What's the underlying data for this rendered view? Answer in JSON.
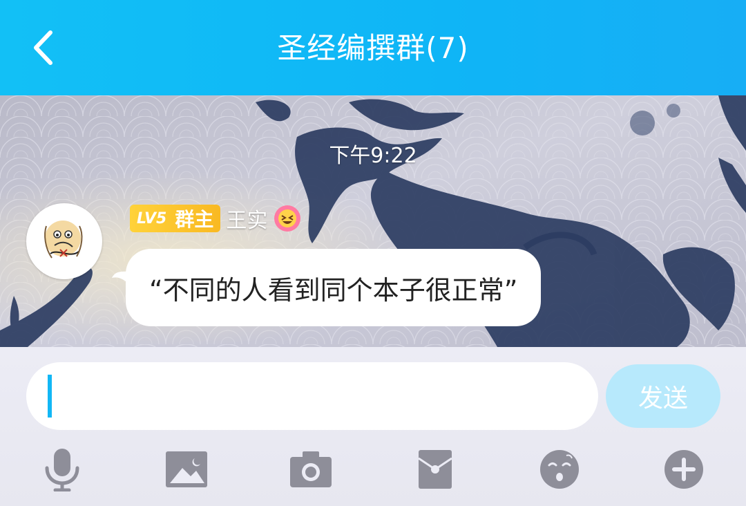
{
  "header": {
    "back_icon": "chevron-left-icon",
    "title": "圣经编撰群(7)"
  },
  "chat": {
    "timestamp": "下午9:22",
    "messages": [
      {
        "avatar_icon": "user-avatar",
        "level_badge": "LV5",
        "role_badge": "群主",
        "sender": "王实",
        "sender_emoji": "😆",
        "text": "“不同的人看到同个本子很正常”"
      }
    ]
  },
  "composer": {
    "input_value": "",
    "send_label": "发送"
  },
  "toolbar": {
    "items": [
      "microphone-icon",
      "image-icon",
      "camera-icon",
      "red-packet-icon",
      "emoji-icon",
      "plus-icon"
    ]
  },
  "colors": {
    "header": "#12c0f6",
    "accent": "#12b7f5",
    "send_disabled": "#b7e9fc",
    "badge": "#f9c22c",
    "toolbar_icon": "#8e8e99"
  }
}
